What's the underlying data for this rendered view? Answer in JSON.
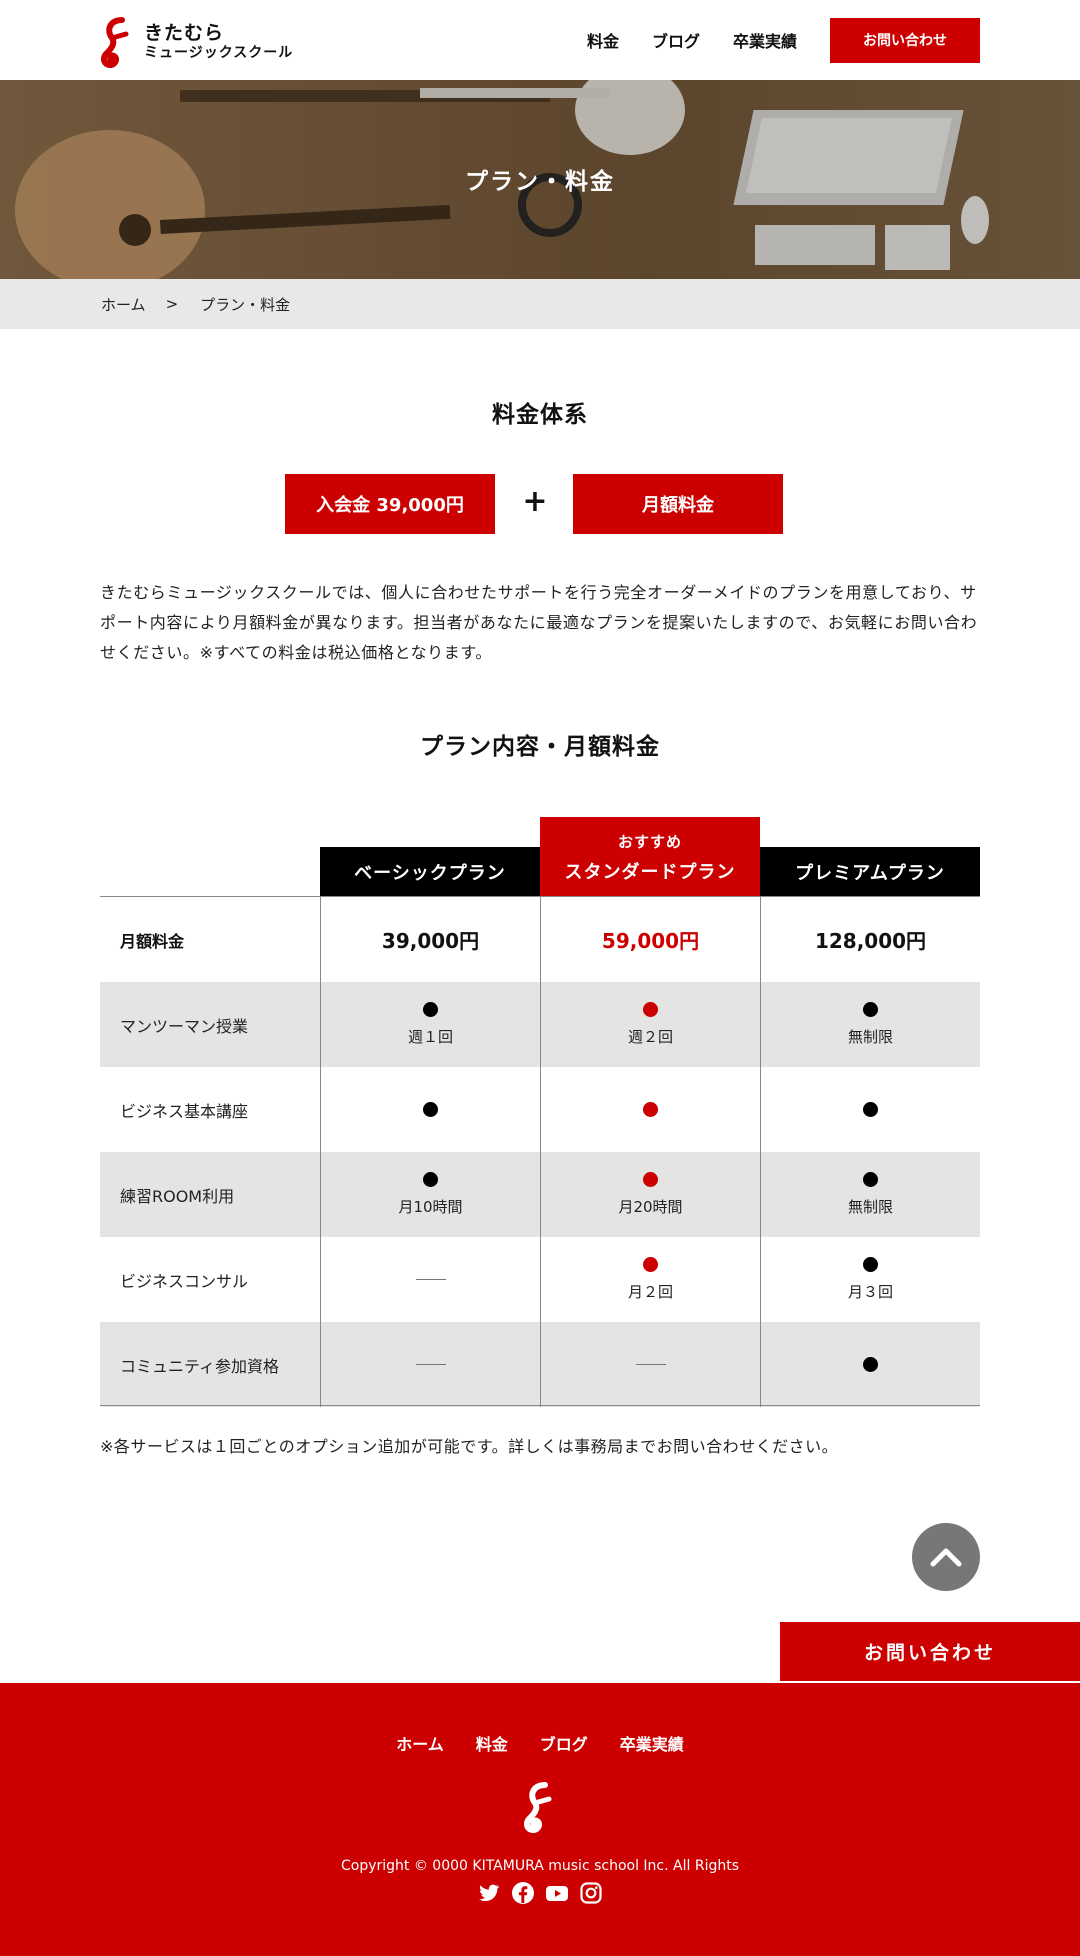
{
  "header": {
    "logo_line1": "きたむら",
    "logo_line2": "ミュージックスクール",
    "nav": [
      "料金",
      "ブログ",
      "卒業実績"
    ],
    "cta": "お問い合わせ"
  },
  "hero": {
    "title": "プラン・料金"
  },
  "breadcrumb": {
    "home": "ホーム",
    "separator": ">",
    "current": "プラン・料金"
  },
  "fee_system": {
    "title": "料金体系",
    "entry_fee": "入会金 39,000円",
    "plus": "+",
    "monthly": "月額料金"
  },
  "intro": "きたむらミュージックスクールでは、個人に合わせたサポートを行う完全オーダーメイドのプランを用意しており、サポート内容により月額料金が異なります。担当者があなたに最適なプランを提案いたしますので、お気軽にお問い合わせください。※すべての料金は税込価格となります。",
  "plans_section": {
    "title": "プラン内容・月額料金",
    "recommend_label": "おすすめ",
    "plans": [
      "ベーシックプラン",
      "スタンダードプラン",
      "プレミアムプラン"
    ],
    "rows": [
      {
        "label": "月額料金",
        "cells": [
          "39,000円",
          "59,000円",
          "128,000円"
        ]
      },
      {
        "label": "マンツーマン授業",
        "cells": [
          "週１回",
          "週２回",
          "無制限"
        ]
      },
      {
        "label": "ビジネス基本講座",
        "cells": [
          "",
          "",
          ""
        ]
      },
      {
        "label": "練習ROOM利用",
        "cells": [
          "月10時間",
          "月20時間",
          "無制限"
        ]
      },
      {
        "label": "ビジネスコンサル",
        "cells": [
          "",
          "月２回",
          "月３回"
        ]
      },
      {
        "label": "コミュニティ参加資格",
        "cells": [
          "",
          "",
          ""
        ]
      }
    ]
  },
  "note": "※各サービスは１回ごとのオプション追加が可能です。詳しくは事務局までお問い合わせください。",
  "float_cta": "お問い合わせ",
  "footer": {
    "nav": [
      "ホーム",
      "料金",
      "ブログ",
      "卒業実績"
    ],
    "copyright": "Copyright © 0000 KITAMURA music school Inc. All Rights"
  },
  "colors": {
    "accent": "#cc0000",
    "header_black": "#000000",
    "shade": "#e4e4e4"
  }
}
